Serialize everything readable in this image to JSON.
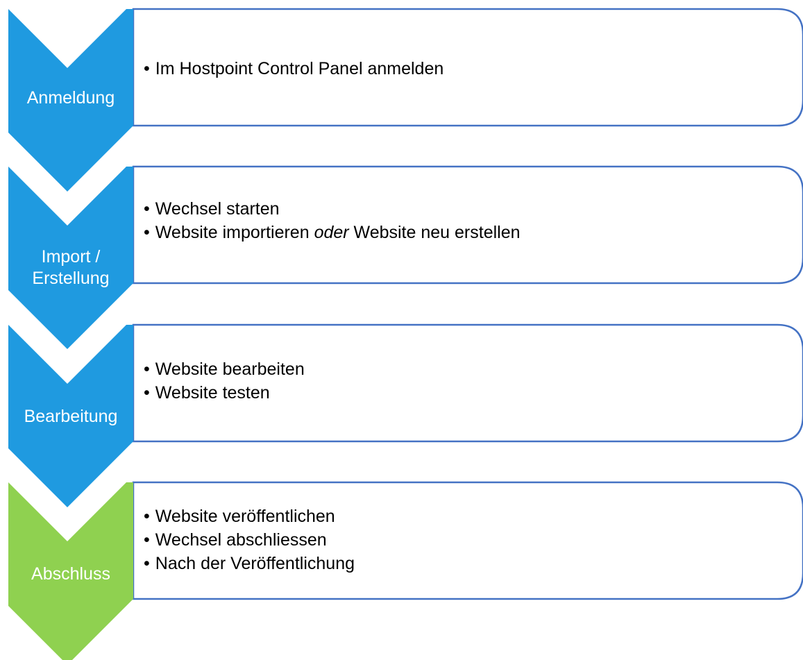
{
  "colors": {
    "blue_step": "#1f9ae0",
    "green_step": "#8fd150",
    "box_border": "#4472c4",
    "label_text": "#ffffff",
    "body_text": "#000000"
  },
  "steps": [
    {
      "label_lines": [
        "Anmeldung"
      ],
      "bullets": [
        {
          "text": "Im Hostpoint Control Panel anmelden"
        }
      ]
    },
    {
      "label_lines": [
        "Import /",
        "Erstellung"
      ],
      "bullets": [
        {
          "text": "Wechsel starten"
        },
        {
          "before": "Website importieren ",
          "emph": "oder",
          "after": " Website neu erstellen"
        }
      ]
    },
    {
      "label_lines": [
        "Bearbeitung"
      ],
      "bullets": [
        {
          "text": "Website bearbeiten"
        },
        {
          "text": "Website testen"
        }
      ]
    },
    {
      "label_lines": [
        "Abschluss"
      ],
      "bullets": [
        {
          "text": "Website veröffentlichen"
        },
        {
          "text": "Wechsel abschliessen"
        },
        {
          "text": "Nach der Veröffentlichung"
        }
      ]
    }
  ]
}
